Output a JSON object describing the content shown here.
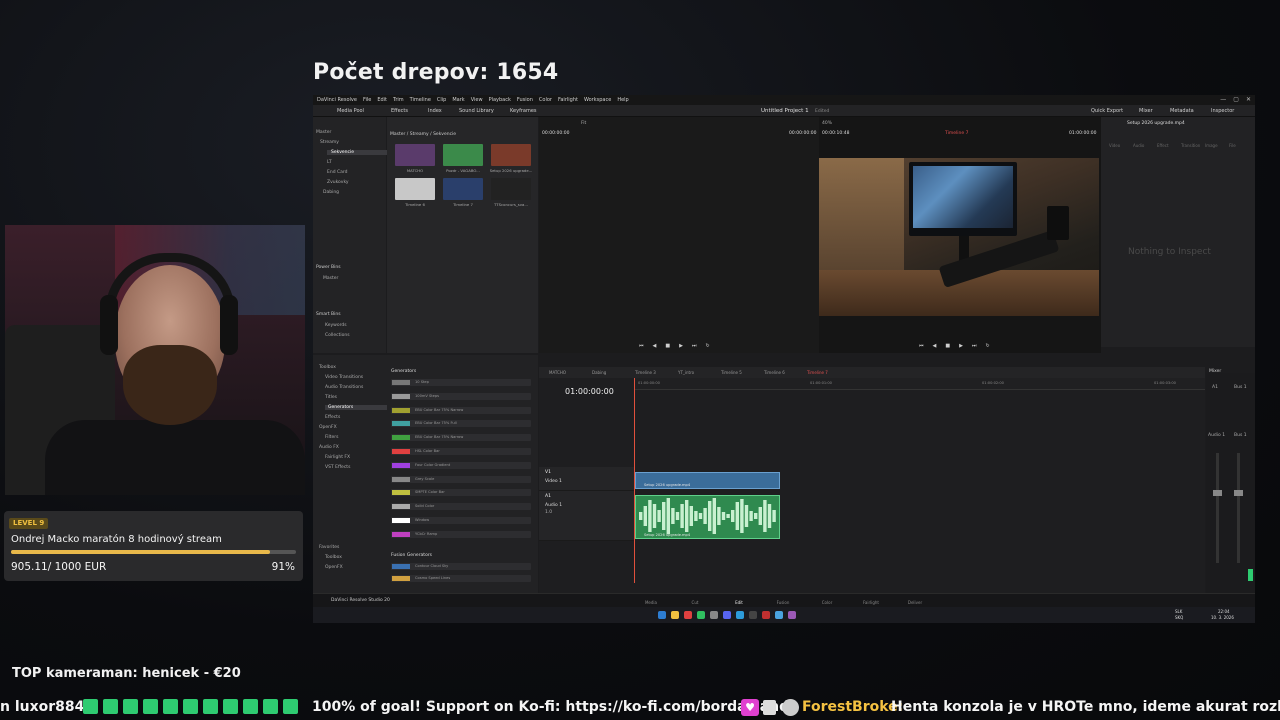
{
  "counter": {
    "label": "Počet drepov: 1654"
  },
  "app": {
    "menu": [
      "DaVinci Resolve",
      "File",
      "Edit",
      "Trim",
      "Timeline",
      "Clip",
      "Mark",
      "View",
      "Playback",
      "Fusion",
      "Color",
      "Fairlight",
      "Workspace",
      "Help"
    ],
    "window_controls": [
      "—",
      "▢",
      "✕"
    ],
    "toolbar": {
      "media_pool": "Media Pool",
      "effects": "Effects",
      "index": "Index",
      "sound_library": "Sound Library",
      "keyframes": "Keyframes",
      "quick_export": "Quick Export",
      "mixer": "Mixer",
      "metadata": "Metadata",
      "inspector": "Inspector"
    },
    "project_title": "Untitled Project 1",
    "project_state": "Edited",
    "bins": {
      "breadcrumb": "Master / Streamy / Sekvencie",
      "items": [
        "Master",
        "Streamy",
        "Sekvencie",
        "LT",
        "End Card",
        "Zvukovky",
        "Dabing"
      ],
      "power_bins": "Power Bins",
      "power_items": [
        "Master"
      ],
      "smart_bins": "Smart Bins",
      "smart_items": [
        "Keywords",
        "Collections"
      ]
    },
    "clips": [
      {
        "name": "MATCHO",
        "color": "#5a3b6b"
      },
      {
        "name": "Pozdr - VAGABO...",
        "color": "#3b8a4a"
      },
      {
        "name": "Setup 2026 upgrade...",
        "color": "#7a3a2a"
      },
      {
        "name": "Timeline 6",
        "color": "#c8c8c8"
      },
      {
        "name": "Timeline 7",
        "color": "#2a3f6b"
      },
      {
        "name": "TTSconcurs_sva...",
        "color": "#222"
      }
    ],
    "source": {
      "tc_left": "00:00:00:00",
      "tc_right": "00:00:00:00",
      "zoom": "Fit"
    },
    "program": {
      "zoom": "40%",
      "tc_left": "00:00:10:48",
      "timeline_name": "Timeline 7",
      "tc_right": "01:00:00:00"
    },
    "inspector": {
      "file": "Setup 2026 upgrade.mp4",
      "tabs": [
        "Video",
        "Audio",
        "Effect",
        "Transition",
        "Image",
        "File"
      ],
      "empty": "Nothing to Inspect"
    },
    "effects": {
      "groups": [
        "Toolbox",
        "Video Transitions",
        "Audio Transitions",
        "Titles",
        "Generators",
        "Effects",
        "OpenFX",
        "Filters",
        "Audio FX",
        "Fairlight FX",
        "VST Effects"
      ],
      "favorites": [
        "Favorites",
        "Toolbox",
        "OpenFX"
      ],
      "header": "Generators",
      "items": [
        {
          "name": "10 Step",
          "color": "#777"
        },
        {
          "name": "100mV Steps",
          "color": "#999"
        },
        {
          "name": "EBU Color Bar 75% Narrow",
          "color": "#a0a030"
        },
        {
          "name": "EBU Color Bar 75% Full",
          "color": "#40a0a0"
        },
        {
          "name": "EBU Color Bar 75% Narrow",
          "color": "#40a040"
        },
        {
          "name": "HSL Color Bar",
          "color": "#e04040"
        },
        {
          "name": "Four Color Gradient",
          "color": "#a040e0"
        },
        {
          "name": "Grey Scale",
          "color": "#888"
        },
        {
          "name": "SMPTE Color Bar",
          "color": "#c0c040"
        },
        {
          "name": "Solid Color",
          "color": "#aaa"
        },
        {
          "name": "Window",
          "color": "#fff"
        },
        {
          "name": "YCbCr Ramp",
          "color": "#c040c0"
        }
      ],
      "fusion_header": "Fusion Generators",
      "fusion_items": [
        {
          "name": "Contour Cloud Sky",
          "color": "#3a70b0"
        },
        {
          "name": "Cosmo Speed Lines",
          "color": "#d0a040"
        }
      ]
    },
    "timeline": {
      "tabs": [
        "MATCHO",
        "Dabing",
        "Timeline 3",
        "YT_intro",
        "Timeline 5",
        "Timeline 6",
        "Timeline 7"
      ],
      "timecode": "01:00:00:00",
      "ruler": [
        "01:00:00:00",
        "01:00:01:00",
        "01:00:02:00",
        "01:00:03:00"
      ],
      "video_track": {
        "id": "V1",
        "name": "Video 1"
      },
      "audio_track": {
        "id": "A1",
        "name": "Audio 1",
        "level": "1.0"
      },
      "video_clip": "Setup 2026 upgrade.mp4",
      "audio_clip": "Setup 2026 upgrade.mp4"
    },
    "mixer": {
      "title": "Mixer",
      "ch1": "A1",
      "ch2": "Bus 1",
      "ch1b": "Audio 1",
      "ch2b": "Bus 1"
    },
    "pages": [
      "Media",
      "Cut",
      "Edit",
      "Fusion",
      "Color",
      "Fairlight",
      "Deliver"
    ],
    "active_page": "Edit",
    "brand": "DaVinci Resolve Studio 20",
    "taskbar": {
      "lang_top": "SLK",
      "lang_bottom": "SKQ",
      "time": "22:04",
      "date": "10. 3. 2026"
    }
  },
  "goal": {
    "level": "LEVEL 9",
    "title": "Ondrej Macko maratón 8 hodinový stream",
    "amount": "905.11/ 1000 EUR",
    "percent": "91%",
    "progress": 0.91
  },
  "top_camera": "TOP kameraman: henicek - €20",
  "ticker": {
    "start": "n luxor884!",
    "goal_text": "100% of goal! Support on Ko-fi: https://ko-fi.com/bordaclands",
    "user": "ForestBroke:",
    "message": "Henta konzola je v HROTe  mno, ideme akurat rozbalovat"
  },
  "colors": {
    "accent_green": "#2ecc71",
    "goal_fill": "#e8b84a",
    "playhead": "#e0503c",
    "video_clip": "#3b6d9a",
    "audio_clip": "#2f8a4f"
  }
}
